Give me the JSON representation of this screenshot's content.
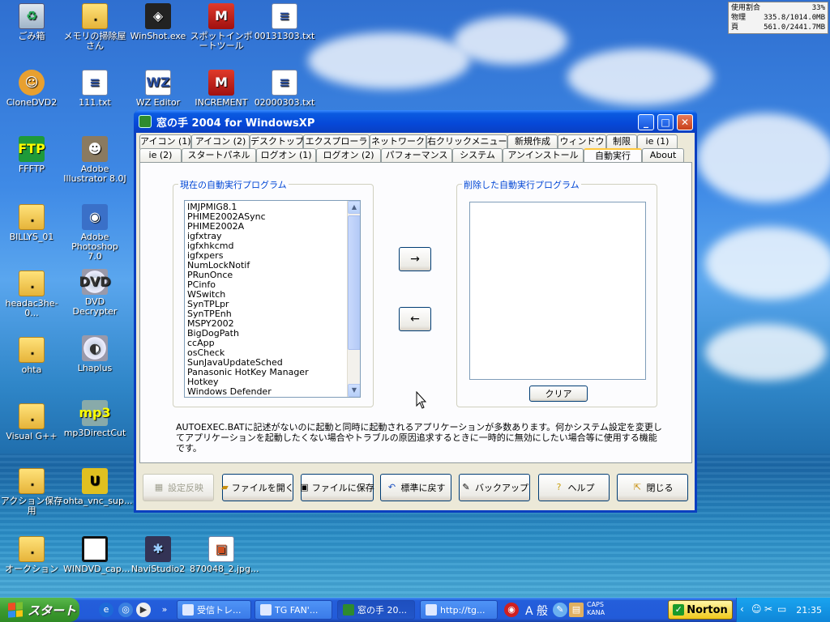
{
  "desktop": {
    "icons": [
      {
        "label": "ごみ箱",
        "icon": "recycle-bin-icon"
      },
      {
        "label": "メモリの掃除屋さん",
        "icon": "folder-icon"
      },
      {
        "label": "WinShot.exe",
        "icon": "winshot-icon"
      },
      {
        "label": "スポットインポートツール",
        "icon": "m-app-icon"
      },
      {
        "label": "00131303.txt",
        "icon": "text-file-icon"
      },
      {
        "label": "CloneDVD2",
        "icon": "clonedvd-icon"
      },
      {
        "label": "111.txt",
        "icon": "text-file-icon"
      },
      {
        "label": "WZ Editor",
        "icon": "wz-editor-icon"
      },
      {
        "label": "INCREMENT",
        "icon": "m-app-icon"
      },
      {
        "label": "02000303.txt",
        "icon": "text-file-icon"
      },
      {
        "label": "FFFTP",
        "icon": "ffftp-icon"
      },
      {
        "label": "Adobe Illustrator 8.0J",
        "icon": "illustrator-icon"
      },
      {
        "label": "BILLYS_01",
        "icon": "folder-icon"
      },
      {
        "label": "Adobe Photoshop 7.0",
        "icon": "photoshop-icon"
      },
      {
        "label": "headac3he-0...",
        "icon": "folder-icon"
      },
      {
        "label": "DVD Decrypter",
        "icon": "dvd-icon"
      },
      {
        "label": "ohta",
        "icon": "folder-icon"
      },
      {
        "label": "Lhaplus",
        "icon": "lhaplus-icon"
      },
      {
        "label": "Visual G++",
        "icon": "folder-icon"
      },
      {
        "label": "mp3DirectCut",
        "icon": "mp3directcut-icon"
      },
      {
        "label": "アクション保存用",
        "icon": "folder-icon"
      },
      {
        "label": "ohta_vnc_sup...",
        "icon": "vnc-icon"
      },
      {
        "label": "オークション",
        "icon": "folder-icon"
      },
      {
        "label": "WINDVD_cap...",
        "icon": "image-file-icon"
      },
      {
        "label": "NaviStudio2",
        "icon": "navistudio-icon"
      },
      {
        "label": "870048_2.jpg...",
        "icon": "jpg-file-icon"
      }
    ]
  },
  "sysmon": {
    "rows": [
      {
        "label": "使用割合",
        "value": "33%"
      },
      {
        "label": "物理",
        "value": "335.8/1014.0MB"
      },
      {
        "label": "頁",
        "value": "561.0/2441.7MB"
      }
    ]
  },
  "window": {
    "title": "窓の手 2004 for WindowsXP",
    "controls": {
      "minimize": "_",
      "maximize": "□",
      "close": "✕"
    },
    "tabs_row1": [
      "アイコン (1)",
      "アイコン (2)",
      "デスクトップ",
      "エクスプローラ",
      "ネットワーク",
      "右クリックメニュー",
      "新規作成",
      "ウィンドウ",
      "制限",
      "ie (1)"
    ],
    "tabs_row2": [
      "ie (2)",
      "スタートパネル",
      "ログオン (1)",
      "ログオン (2)",
      "パフォーマンス",
      "システム",
      "アンインストール",
      "自動実行",
      "About"
    ],
    "active_tab": "自動実行",
    "current_group_label": "現在の自動実行プログラム",
    "removed_group_label": "削除した自動実行プログラム",
    "current_programs": [
      "IMJPMIG8.1",
      "PHIME2002ASync",
      "PHIME2002A",
      "igfxtray",
      "igfxhkcmd",
      "igfxpers",
      "NumLockNotif",
      "PRunOnce",
      "PCinfo",
      "WSwitch",
      "SynTPLpr",
      "SynTPEnh",
      "MSPY2002",
      "BigDogPath",
      "ccApp",
      "osCheck",
      "SunJavaUpdateSched",
      "Panasonic HotKey Manager",
      "Hotkey",
      "Windows Defender"
    ],
    "move_right_label": "→",
    "move_left_label": "←",
    "clear_label": "クリア",
    "description": "AUTOEXEC.BATに記述がないのに起動と同時に起動されるアプリケーションが多数あります。何かシステム設定を変更してアプリケーションを起動したくない場合やトラブルの原因追求するときに一時的に無効にしたい場合等に使用する機能です。",
    "buttons": {
      "apply": "設定反映",
      "open_file": "ファイルを開く",
      "save_file": "ファイルに保存",
      "restore_default": "標準に戻す",
      "backup": "バックアップ",
      "help": "ヘルプ",
      "close": "閉じる"
    }
  },
  "taskbar": {
    "start_label": "スタート",
    "tasks": [
      "受信トレ...",
      "TG FAN'...",
      "窓の手 20...",
      "http://tg..."
    ],
    "norton_label": "Norton",
    "ime_label": "般",
    "caps_label": "CAPS",
    "kana_label": "KANA",
    "clock": "21:35"
  },
  "colors": {
    "title_blue": "#0a5ae0",
    "tab_highlight": "#ffc83c",
    "group_label": "#0046d5",
    "start_green": "#3c9a2f"
  }
}
